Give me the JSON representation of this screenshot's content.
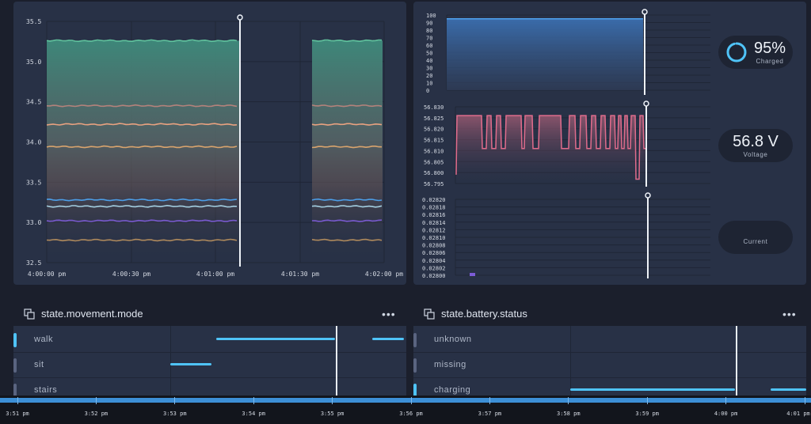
{
  "temp_chart": {
    "y_ticks": [
      "35.5",
      "35.0",
      "34.5",
      "34.0",
      "33.5",
      "33.0",
      "32.5"
    ],
    "x_ticks": [
      "4:00:00 pm",
      "4:00:30 pm",
      "4:01:00 pm",
      "4:01:30 pm",
      "4:02:00 pm"
    ],
    "series_colors": [
      "#63c7a0",
      "#b9847c",
      "#f1a582",
      "#e0a96e",
      "#4da3f0",
      "#a9d6e8",
      "#7c5cd6",
      "#b58e5e"
    ]
  },
  "battery_percent_chart": {
    "y_ticks": [
      "100",
      "90",
      "80",
      "70",
      "60",
      "50",
      "40",
      "30",
      "20",
      "10",
      "0"
    ]
  },
  "voltage_chart": {
    "y_ticks": [
      "56.830",
      "56.825",
      "56.820",
      "56.815",
      "56.810",
      "56.805",
      "56.800",
      "56.795"
    ]
  },
  "current_chart": {
    "y_ticks": [
      "0.02820",
      "0.02818",
      "0.02816",
      "0.02814",
      "0.02812",
      "0.02810",
      "0.02808",
      "0.02806",
      "0.02804",
      "0.02802",
      "0.02800"
    ]
  },
  "gauges": {
    "charge": {
      "value": "95%",
      "label": "Charged",
      "fraction": 0.95
    },
    "voltage": {
      "value": "56.8 V",
      "label": "Voltage"
    },
    "current": {
      "value": "",
      "label": "Current"
    }
  },
  "movement": {
    "title": "state.movement.mode",
    "more": "•••",
    "states": [
      "walk",
      "sit",
      "stairs"
    ]
  },
  "battery_status": {
    "title": "state.battery.status",
    "more": "•••",
    "states": [
      "unknown",
      "missing",
      "charging"
    ]
  },
  "timeline": {
    "ticks": [
      "3:51 pm",
      "3:52 pm",
      "3:53 pm",
      "3:54 pm",
      "3:55 pm",
      "3:56 pm",
      "3:57 pm",
      "3:58 pm",
      "3:59 pm",
      "4:00 pm",
      "4:01 pm"
    ]
  },
  "colors": {
    "accent": "#4fc3f7",
    "panel": "#283146",
    "voltage_line": "#e06c8c",
    "battery_fill": "#3b6fb0",
    "current_bar": "#7c5cd6"
  }
}
